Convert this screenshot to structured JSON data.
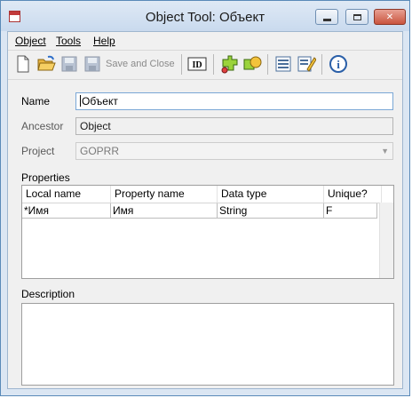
{
  "window": {
    "title": "Object Tool: Объект",
    "accent_color": "#5a8ab8"
  },
  "menu": {
    "items": [
      {
        "label": "Object"
      },
      {
        "label": "Tools"
      },
      {
        "label": "Help"
      }
    ]
  },
  "toolbar": {
    "save_and_close_label": "Save and Close",
    "id_button_label": "ID",
    "info_icon_glyph": "i",
    "icons": [
      "new-document-icon",
      "open-folder-icon",
      "save-disk-icon",
      "save-and-close-icon",
      "id-icon",
      "properties-icon",
      "graph-shapes-icon",
      "form-icon",
      "edit-icon",
      "info-icon"
    ]
  },
  "form": {
    "name_label": "Name",
    "name_value": "Объект",
    "ancestor_label": "Ancestor",
    "ancestor_value": "Object",
    "project_label": "Project",
    "project_value": "GOPRR"
  },
  "properties": {
    "section_label": "Properties",
    "columns": [
      "Local name",
      "Property name",
      "Data type",
      "Unique?"
    ],
    "rows": [
      [
        "*Имя",
        "Имя",
        "String",
        "F"
      ]
    ]
  },
  "description": {
    "section_label": "Description",
    "value": ""
  }
}
